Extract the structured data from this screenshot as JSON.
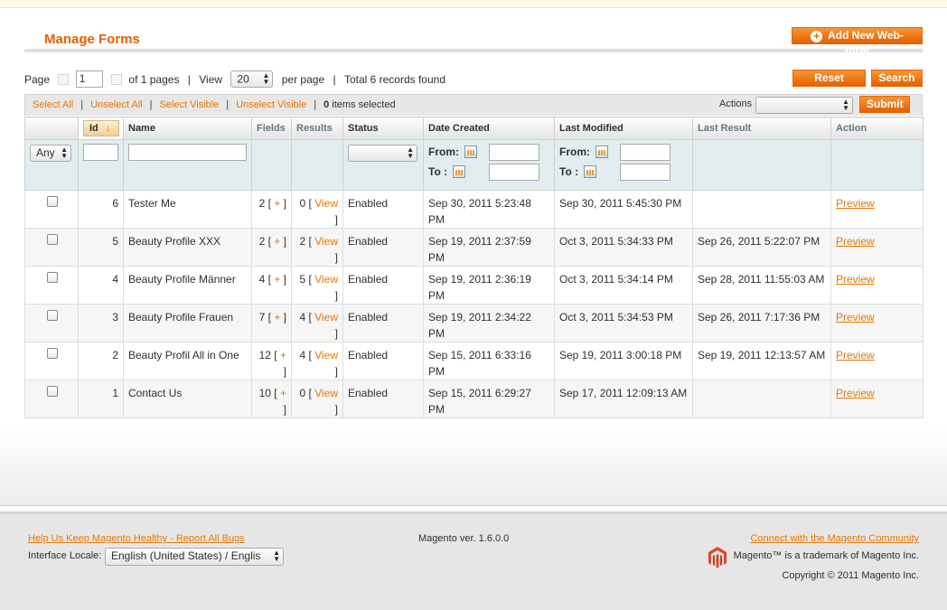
{
  "page": {
    "title": "Manage Forms",
    "add_button": "Add New Web-form"
  },
  "pager": {
    "page_label": "Page",
    "page_value": "1",
    "of_pages": "of 1 pages",
    "view_label": "View",
    "view_value": "20",
    "per_page": "per page",
    "total": "Total 6 records found"
  },
  "buttons": {
    "reset_filter": "Reset Filter",
    "search": "Search",
    "submit": "Submit"
  },
  "massaction": {
    "select_all": "Select All",
    "unselect_all": "Unselect All",
    "select_visible": "Select Visible",
    "unselect_visible": "Unselect Visible",
    "selected_count": "0",
    "selected_suffix": " items selected",
    "actions_label": "Actions"
  },
  "columns": {
    "id": "Id",
    "name": "Name",
    "fields": "Fields",
    "results": "Results",
    "status": "Status",
    "date_created": "Date Created",
    "last_modified": "Last Modified",
    "last_result": "Last Result",
    "action": "Action"
  },
  "filters": {
    "any": "Any",
    "from": "From:",
    "to": "To :"
  },
  "rows": [
    {
      "id": "6",
      "name": "Tester Me",
      "fields": "2 [ + ]",
      "results": "0 [ View ]",
      "status": "Enabled",
      "created": "Sep 30, 2011 5:23:48 PM",
      "modified": "Sep 30, 2011 5:45:30 PM",
      "last_result": "",
      "action": "Preview"
    },
    {
      "id": "5",
      "name": "Beauty Profile XXX",
      "fields": "2 [ + ]",
      "results": "2 [ View ]",
      "status": "Enabled",
      "created": "Sep 19, 2011 2:37:59 PM",
      "modified": "Oct 3, 2011 5:34:33 PM",
      "last_result": "Sep 26, 2011 5:22:07 PM",
      "action": "Preview"
    },
    {
      "id": "4",
      "name": "Beauty Profile Männer",
      "fields": "4 [ + ]",
      "results": "5 [ View ]",
      "status": "Enabled",
      "created": "Sep 19, 2011 2:36:19 PM",
      "modified": "Oct 3, 2011 5:34:14 PM",
      "last_result": "Sep 28, 2011 11:55:03 AM",
      "action": "Preview"
    },
    {
      "id": "3",
      "name": "Beauty Profile Frauen",
      "fields": "7 [ + ]",
      "results": "4 [ View ]",
      "status": "Enabled",
      "created": "Sep 19, 2011 2:34:22 PM",
      "modified": "Oct 3, 2011 5:34:53 PM",
      "last_result": "Sep 26, 2011 7:17:36 PM",
      "action": "Preview"
    },
    {
      "id": "2",
      "name": "Beauty Profil All in One",
      "fields": "12 [ + ]",
      "results": "4 [ View ]",
      "status": "Enabled",
      "created": "Sep 15, 2011 6:33:16 PM",
      "modified": "Sep 19, 2011 3:00:18 PM",
      "last_result": "Sep 19, 2011 12:13:57 AM",
      "action": "Preview"
    },
    {
      "id": "1",
      "name": "Contact Us",
      "fields": "10 [ + ]",
      "results": "0 [ View ]",
      "status": "Enabled",
      "created": "Sep 15, 2011 6:29:27 PM",
      "modified": "Sep 17, 2011 12:09:13 AM",
      "last_result": "",
      "action": "Preview"
    }
  ],
  "footer": {
    "help_link": "Help Us Keep Magento Healthy - Report All Bugs",
    "locale_label": "Interface Locale:",
    "locale_value": "English (United States) / Englis",
    "version": "Magento ver. 1.6.0.0",
    "community_link": "Connect with the Magento Community",
    "trademark": "Magento™ is a trademark of Magento Inc.",
    "copyright": "Copyright © 2011 Magento Inc."
  },
  "colors": {
    "accent": "#ea7601",
    "button": "#f18200",
    "filter_bg": "#e3edef"
  }
}
